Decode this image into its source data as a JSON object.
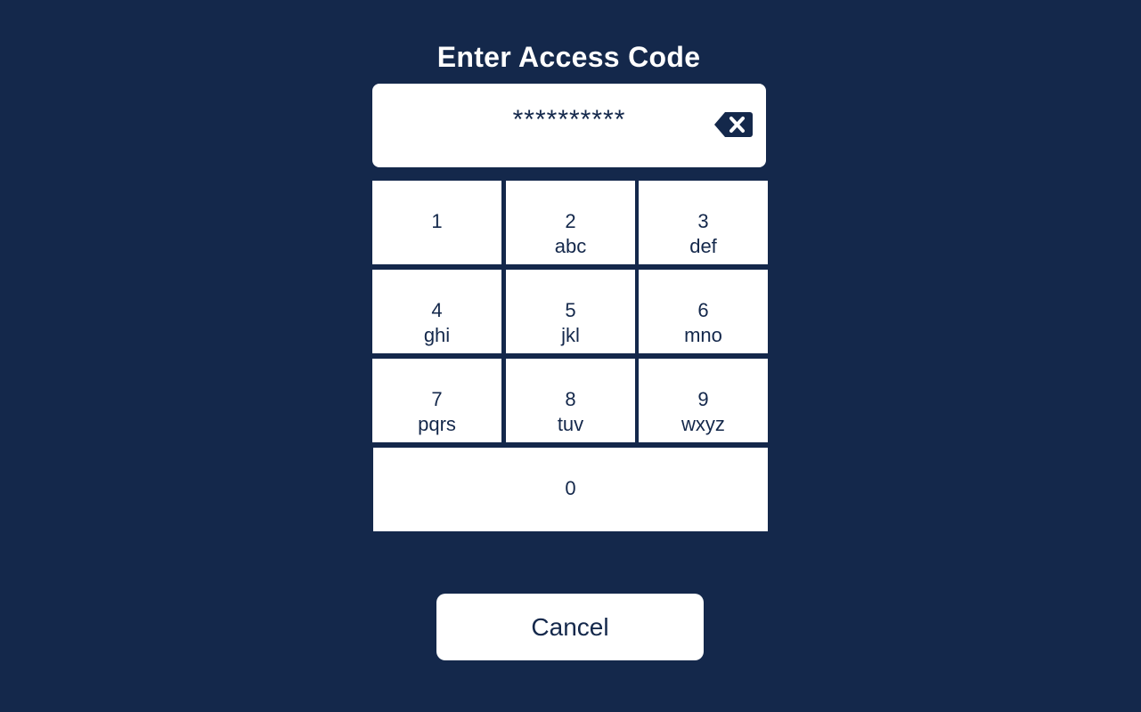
{
  "title": "Enter Access Code",
  "display": {
    "masked_code": "**********",
    "backspace_icon": "backspace-icon"
  },
  "keypad": {
    "keys": [
      {
        "digit": "1",
        "letters": ""
      },
      {
        "digit": "2",
        "letters": "abc"
      },
      {
        "digit": "3",
        "letters": "def"
      },
      {
        "digit": "4",
        "letters": "ghi"
      },
      {
        "digit": "5",
        "letters": "jkl"
      },
      {
        "digit": "6",
        "letters": "mno"
      },
      {
        "digit": "7",
        "letters": "pqrs"
      },
      {
        "digit": "8",
        "letters": "tuv"
      },
      {
        "digit": "9",
        "letters": "wxyz"
      },
      {
        "digit": "0",
        "letters": ""
      }
    ]
  },
  "cancel_label": "Cancel",
  "colors": {
    "background": "#14284b",
    "key_background": "#ffffff",
    "text": "#14284b"
  }
}
